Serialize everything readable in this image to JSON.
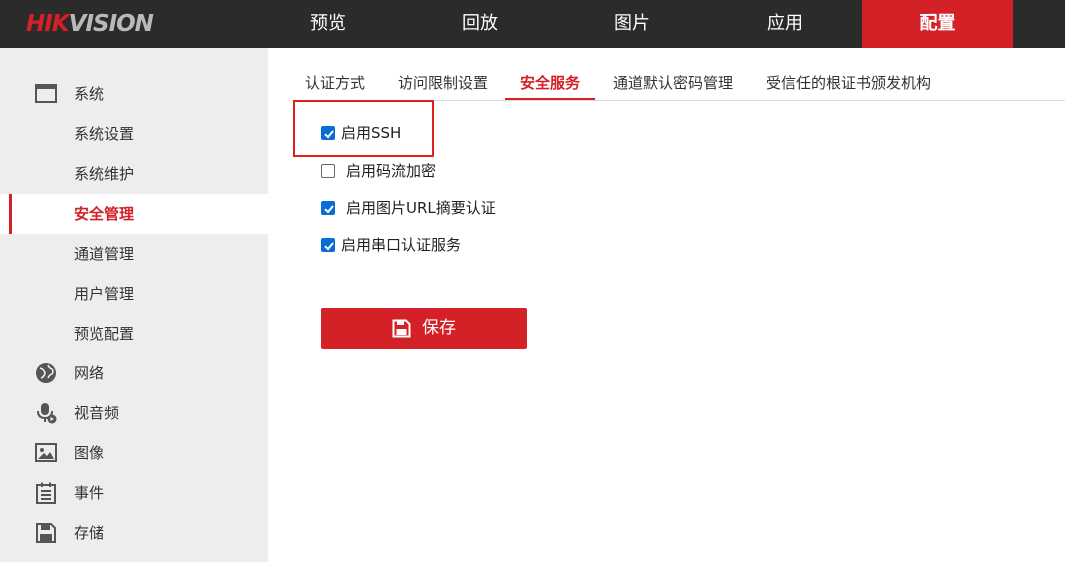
{
  "brand": {
    "part1": "HIK",
    "part2": "VISION"
  },
  "topnav": [
    {
      "label": "预览"
    },
    {
      "label": "回放"
    },
    {
      "label": "图片"
    },
    {
      "label": "应用"
    },
    {
      "label": "配置"
    }
  ],
  "sidebar": {
    "items": [
      {
        "label": "系统",
        "icon": "monitor-icon"
      },
      {
        "label": "系统设置"
      },
      {
        "label": "系统维护"
      },
      {
        "label": "安全管理"
      },
      {
        "label": "通道管理"
      },
      {
        "label": "用户管理"
      },
      {
        "label": "预览配置"
      },
      {
        "label": "网络",
        "icon": "globe-icon"
      },
      {
        "label": "视音频",
        "icon": "microphone-icon"
      },
      {
        "label": "图像",
        "icon": "image-icon"
      },
      {
        "label": "事件",
        "icon": "calendar-list-icon"
      },
      {
        "label": "存储",
        "icon": "floppy-disk-icon"
      }
    ]
  },
  "tabs": [
    {
      "label": "认证方式"
    },
    {
      "label": "访问限制设置"
    },
    {
      "label": "安全服务"
    },
    {
      "label": "通道默认密码管理"
    },
    {
      "label": "受信任的根证书颁发机构"
    }
  ],
  "options": [
    {
      "label": "启用SSH",
      "checked": true
    },
    {
      "label": "启用码流加密",
      "checked": false
    },
    {
      "label": "启用图片URL摘要认证",
      "checked": true
    },
    {
      "label": "启用串口认证服务",
      "checked": true
    }
  ],
  "save": {
    "label": "保存",
    "icon": "floppy-disk-icon"
  },
  "colors": {
    "accent": "#d42027",
    "checkbox": "#0a6cd6",
    "topbar": "#2b2b2b",
    "sidebar": "#ededed"
  }
}
